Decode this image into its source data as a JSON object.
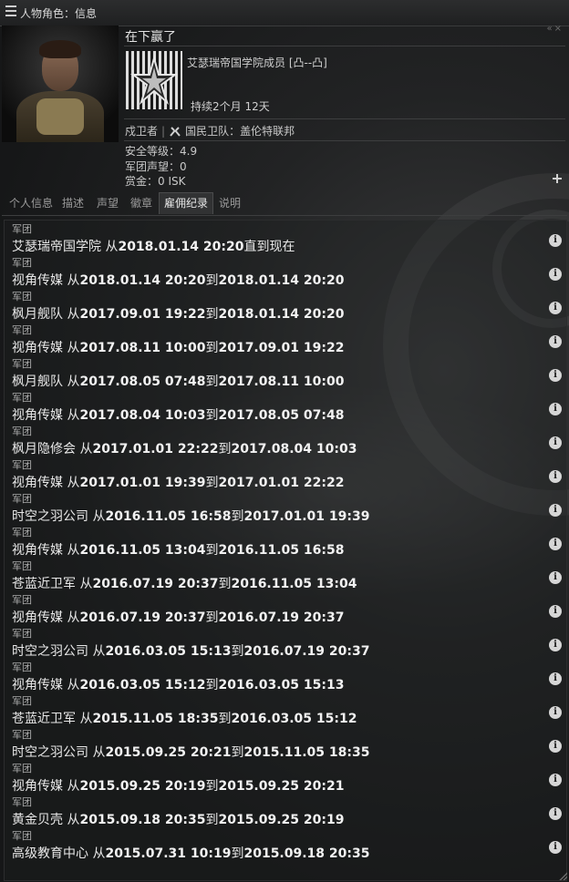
{
  "window": {
    "title": "人物角色：信息"
  },
  "character": {
    "name": "在下赢了",
    "corp_name": "艾瑟瑞帝国学院成员 [凸--凸]",
    "corp_duration": "持续2个月 12天",
    "militia_role": "戍卫者",
    "militia_name": "国民卫队：盖伦特联邦",
    "security_status": "安全等级：4.9",
    "corp_standing": "军团声望：0",
    "bounty": "赏金：0 ISK"
  },
  "tabs": [
    {
      "label": "个人信息",
      "active": false
    },
    {
      "label": "描述",
      "active": false
    },
    {
      "label": "声望",
      "active": false
    },
    {
      "label": "徽章",
      "active": false
    },
    {
      "label": "雇佣纪录",
      "active": true
    },
    {
      "label": "说明",
      "active": false
    }
  ],
  "history": [
    {
      "label": "军团",
      "corp": "艾瑟瑞帝国学院",
      "from_word": "从",
      "from": "2018.01.14 20:20",
      "to_word": "直到现在",
      "to": ""
    },
    {
      "label": "军团",
      "corp": "视角传媒",
      "from_word": "从",
      "from": "2018.01.14 20:20",
      "to_word": "到",
      "to": "2018.01.14 20:20"
    },
    {
      "label": "军团",
      "corp": "枫月舰队",
      "from_word": "从",
      "from": "2017.09.01 19:22",
      "to_word": "到",
      "to": "2018.01.14 20:20"
    },
    {
      "label": "军团",
      "corp": "视角传媒",
      "from_word": "从",
      "from": "2017.08.11 10:00",
      "to_word": "到",
      "to": "2017.09.01 19:22"
    },
    {
      "label": "军团",
      "corp": "枫月舰队",
      "from_word": "从",
      "from": "2017.08.05 07:48",
      "to_word": "到",
      "to": "2017.08.11 10:00"
    },
    {
      "label": "军团",
      "corp": "视角传媒",
      "from_word": "从",
      "from": "2017.08.04 10:03",
      "to_word": "到",
      "to": "2017.08.05 07:48"
    },
    {
      "label": "军团",
      "corp": "枫月隐修会",
      "from_word": "从",
      "from": "2017.01.01 22:22",
      "to_word": "到",
      "to": "2017.08.04 10:03"
    },
    {
      "label": "军团",
      "corp": "视角传媒",
      "from_word": "从",
      "from": "2017.01.01 19:39",
      "to_word": "到",
      "to": "2017.01.01 22:22"
    },
    {
      "label": "军团",
      "corp": "时空之羽公司",
      "from_word": "从",
      "from": "2016.11.05 16:58",
      "to_word": "到",
      "to": "2017.01.01 19:39"
    },
    {
      "label": "军团",
      "corp": "视角传媒",
      "from_word": "从",
      "from": "2016.11.05 13:04",
      "to_word": "到",
      "to": "2016.11.05 16:58"
    },
    {
      "label": "军团",
      "corp": "苍蓝近卫军",
      "from_word": "从",
      "from": "2016.07.19 20:37",
      "to_word": "到",
      "to": "2016.11.05 13:04"
    },
    {
      "label": "军团",
      "corp": "视角传媒",
      "from_word": "从",
      "from": "2016.07.19 20:37",
      "to_word": "到",
      "to": "2016.07.19 20:37"
    },
    {
      "label": "军团",
      "corp": "时空之羽公司",
      "from_word": "从",
      "from": "2016.03.05 15:13",
      "to_word": "到",
      "to": "2016.07.19 20:37"
    },
    {
      "label": "军团",
      "corp": "视角传媒",
      "from_word": "从",
      "from": "2016.03.05 15:12",
      "to_word": "到",
      "to": "2016.03.05 15:13"
    },
    {
      "label": "军团",
      "corp": "苍蓝近卫军",
      "from_word": "从",
      "from": "2015.11.05 18:35",
      "to_word": "到",
      "to": "2016.03.05 15:12"
    },
    {
      "label": "军团",
      "corp": "时空之羽公司",
      "from_word": "从",
      "from": "2015.09.25 20:21",
      "to_word": "到",
      "to": "2015.11.05 18:35"
    },
    {
      "label": "军团",
      "corp": "视角传媒",
      "from_word": "从",
      "from": "2015.09.25 20:19",
      "to_word": "到",
      "to": "2015.09.25 20:21"
    },
    {
      "label": "军团",
      "corp": "黄金贝壳",
      "from_word": "从",
      "from": "2015.09.18 20:35",
      "to_word": "到",
      "to": "2015.09.25 20:19"
    },
    {
      "label": "军团",
      "corp": "高级教育中心",
      "from_word": "从",
      "from": "2015.07.31 10:19",
      "to_word": "到",
      "to": "2015.09.18 20:35"
    }
  ]
}
